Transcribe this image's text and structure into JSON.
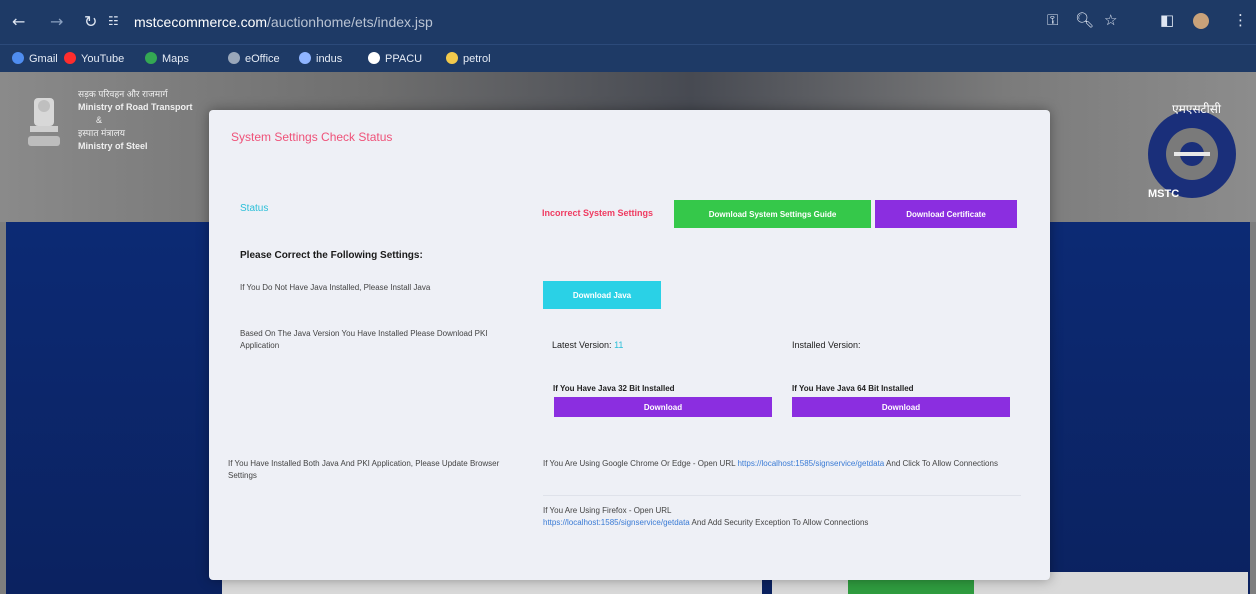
{
  "browser": {
    "url_domain": "mstcecommerce.com",
    "url_path": "/auctionhome/ets/index.jsp",
    "bookmarks": [
      {
        "label": "Gmail",
        "color": "#4f8df0"
      },
      {
        "label": "YouTube",
        "color": "#ff2d2d"
      },
      {
        "label": "Maps",
        "color": "#34a853"
      },
      {
        "label": "eOffice",
        "color": "#9aa7ba"
      },
      {
        "label": "indus",
        "color": "#8fb4ff"
      },
      {
        "label": "PPACU",
        "color": "#ffffff"
      },
      {
        "label": "petrol",
        "color": "#f2c94c"
      }
    ]
  },
  "site": {
    "gov_line1": "सड़क परिवहन और राजमार्ग",
    "gov_line2": "Ministry of Road Transport",
    "gov_line3": "&",
    "gov_line4": "इस्पात मंत्रालय",
    "gov_line5": "Ministry of Steel",
    "mstc_hindi": "एमएसटीसी",
    "mstc_label": "MSTC"
  },
  "modal": {
    "title": "System Settings Check Status",
    "status_label": "Status",
    "status_value": "Incorrect System Settings",
    "download_guide": "Download System Settings Guide",
    "download_certificate": "Download Certificate",
    "heading": "Please Correct the Following Settings:",
    "java_text": "If You Do Not Have Java Installed, Please Install Java",
    "download_java": "Download Java",
    "pki_text": "Based On The Java Version You Have Installed Please Download PKI Application",
    "latest_version_label": "Latest Version:",
    "latest_version_value": "11",
    "installed_version_label": "Installed Version:",
    "java32_label": "If You Have Java 32 Bit Installed",
    "java64_label": "If You Have Java 64 Bit Installed",
    "download32": "Download",
    "download64": "Download",
    "browser_text": "If You Have Installed Both Java And PKI Application, Please Update Browser Settings",
    "chrome_prefix": "If You Are Using Google Chrome Or Edge - Open URL",
    "chrome_url": "https://localhost:1585/signservice/getdata",
    "chrome_suffix": "And Click To Allow Connections",
    "firefox_prefix": "If You Are Using Firefox - Open URL",
    "firefox_url": "https://localhost:1585/signservice/getdata",
    "firefox_suffix": "And Add Security Exception To Allow Connections"
  }
}
